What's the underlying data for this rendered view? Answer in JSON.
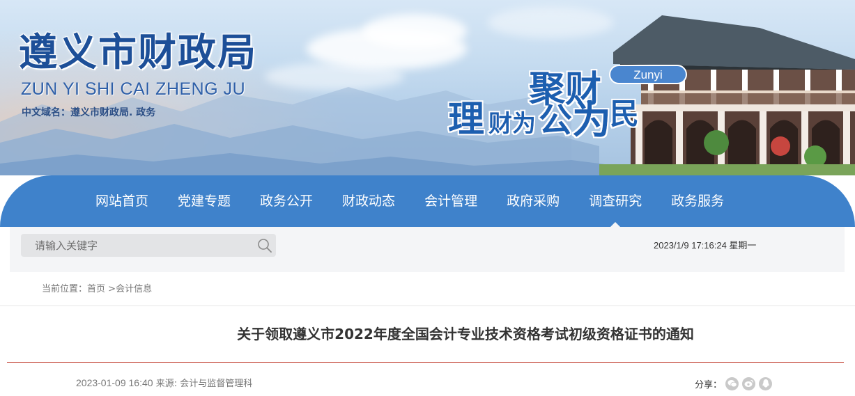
{
  "header": {
    "site_title": "遵义市财政局",
    "site_pinyin": "ZUN YI SHI CAI ZHENG JU",
    "domain_text": "中文域名：遵义市财政局. 政务",
    "slogan": {
      "line1": "聚财",
      "line2_a": "理",
      "line2_b": "财为",
      "line2_c": "公",
      "line2_d": "为",
      "line2_e": "民",
      "badge": "Zunyi"
    }
  },
  "nav": {
    "items": [
      {
        "label": "网站首页"
      },
      {
        "label": "党建专题"
      },
      {
        "label": "政务公开"
      },
      {
        "label": "财政动态"
      },
      {
        "label": "会计管理"
      },
      {
        "label": "政府采购"
      },
      {
        "label": "调查研究"
      },
      {
        "label": "政务服务"
      }
    ],
    "active_label": "调查研究"
  },
  "search": {
    "placeholder": "请输入关键字"
  },
  "datetime": "2023/1/9 17:16:24 星期一",
  "breadcrumb": {
    "prefix": "当前位置：",
    "home": "首页",
    "separator": " >",
    "section": "会计信息"
  },
  "article": {
    "title": "关于领取遵义市2022年度全国会计专业技术资格考试初级资格证书的通知",
    "date": "2023-01-09 16:40",
    "source_label": "来源:",
    "source": "会计与监督管理科"
  },
  "share": {
    "label": "分享：",
    "icons": [
      "wechat-icon",
      "weibo-icon",
      "qq-icon"
    ]
  },
  "colors": {
    "nav_bg": "#3f82cb",
    "title_blue": "#1d4f98",
    "divider_red": "#c0392b",
    "toolbar_bg": "#f4f5f7"
  }
}
